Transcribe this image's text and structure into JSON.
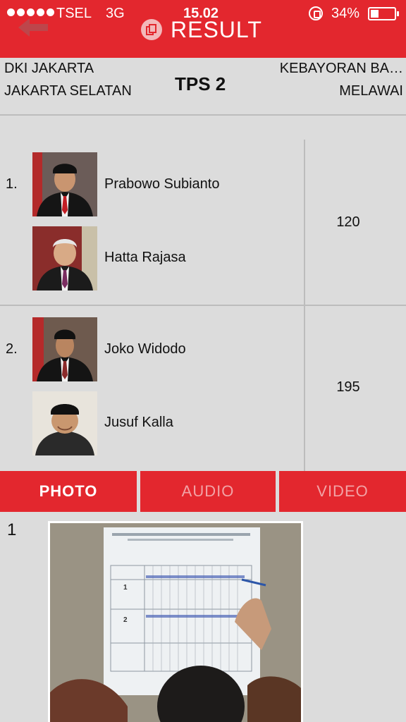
{
  "status_bar": {
    "carrier": "TSEL",
    "network": "3G",
    "time": "15.02",
    "battery": "34%",
    "battery_level": 0.34
  },
  "header": {
    "title": "RESULT",
    "back_icon": "back-arrow-icon",
    "logo_icon": "copy-logo-icon",
    "color": "#e3272e"
  },
  "location": {
    "province": "DKI JAKARTA",
    "city": "JAKARTA SELATAN",
    "tps": "TPS 2",
    "district": "KEBAYORAN BA…",
    "village": "MELAWAI"
  },
  "candidates": [
    {
      "number": "1.",
      "president": "Prabowo Subianto",
      "vice": "Hatta Rajasa",
      "votes": "120"
    },
    {
      "number": "2.",
      "president": "Joko Widodo",
      "vice": "Jusuf Kalla",
      "votes": "195"
    }
  ],
  "tabs": [
    {
      "label": "PHOTO",
      "active": true
    },
    {
      "label": "AUDIO",
      "active": false
    },
    {
      "label": "VIDEO",
      "active": false
    }
  ],
  "media": {
    "index": "1"
  }
}
